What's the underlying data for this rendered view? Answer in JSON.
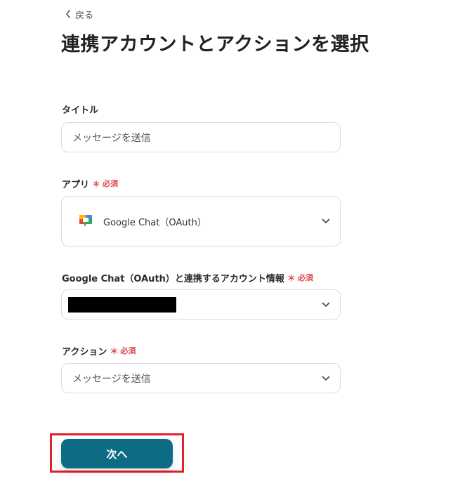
{
  "header": {
    "back_label": "戻る",
    "page_title": "連携アカウントとアクションを選択"
  },
  "form": {
    "title_field": {
      "label": "タイトル",
      "value": "メッセージを送信"
    },
    "app_field": {
      "label": "アプリ",
      "required_mark": "＊",
      "required_text": "必須",
      "selected_app": "Google Chat（OAuth）",
      "icon": "google-chat-logo"
    },
    "account_field": {
      "label": "Google Chat（OAuth）と連携するアカウント情報",
      "required_mark": "＊",
      "required_text": "必須",
      "value_redacted": true
    },
    "action_field": {
      "label": "アクション",
      "required_mark": "＊",
      "required_text": "必須",
      "selected_action": "メッセージを送信"
    }
  },
  "actions": {
    "next_label": "次へ",
    "next_color": "#0d6b84",
    "highlight_color": "#e2202a"
  },
  "colors": {
    "required": "#e0474c",
    "border": "#d9dde2"
  }
}
